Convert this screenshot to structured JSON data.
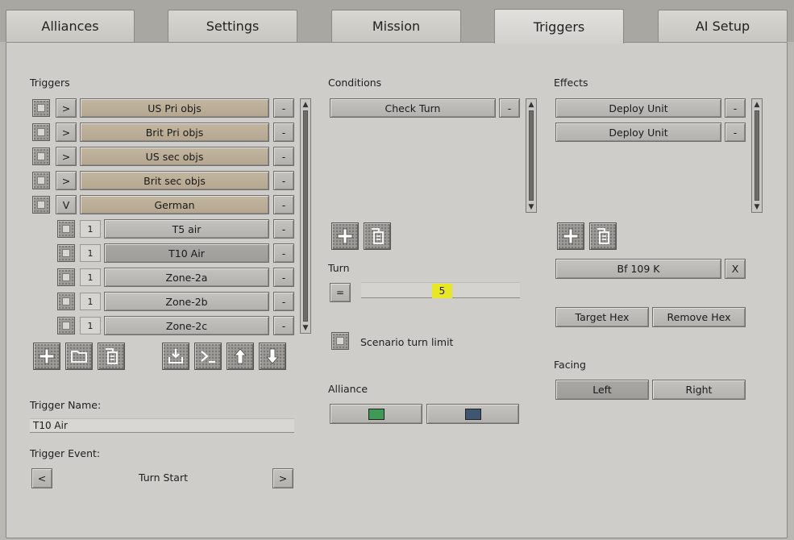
{
  "tabs": [
    {
      "label": "Alliances"
    },
    {
      "label": "Settings"
    },
    {
      "label": "Mission"
    },
    {
      "label": "Triggers"
    },
    {
      "label": "AI Setup"
    }
  ],
  "triggers": {
    "heading": "Triggers",
    "groups": [
      {
        "expander": ">",
        "name": "US Pri objs",
        "remove": "-"
      },
      {
        "expander": ">",
        "name": "Brit Pri objs",
        "remove": "-"
      },
      {
        "expander": ">",
        "name": "US sec objs",
        "remove": "-"
      },
      {
        "expander": ">",
        "name": "Brit sec objs",
        "remove": "-"
      },
      {
        "expander": "V",
        "name": "German",
        "remove": "-"
      }
    ],
    "children": [
      {
        "count": "1",
        "name": "T5 air",
        "remove": "-"
      },
      {
        "count": "1",
        "name": "T10 Air",
        "remove": "-"
      },
      {
        "count": "1",
        "name": "Zone-2a",
        "remove": "-"
      },
      {
        "count": "1",
        "name": "Zone-2b",
        "remove": "-"
      },
      {
        "count": "1",
        "name": "Zone-2c",
        "remove": "-"
      }
    ],
    "name_label": "Trigger Name:",
    "name_value": "T10 Air",
    "event_label": "Trigger Event:",
    "event_prev": "<",
    "event_value": "Turn Start",
    "event_next": ">"
  },
  "conditions": {
    "heading": "Conditions",
    "items": [
      {
        "name": "Check Turn",
        "remove": "-"
      }
    ],
    "turn_label": "Turn",
    "turn_operator": "=",
    "turn_value": "5",
    "scenario_limit_label": "Scenario turn limit",
    "alliance_label": "Alliance",
    "alliance_colors": {
      "first": "#3f9a55",
      "second": "#3e5670"
    }
  },
  "effects": {
    "heading": "Effects",
    "items": [
      {
        "name": "Deploy Unit",
        "remove": "-"
      },
      {
        "name": "Deploy Unit",
        "remove": "-"
      }
    ],
    "unit_value": "Bf 109 K",
    "unit_clear": "X",
    "target_hex": "Target Hex",
    "remove_hex": "Remove Hex",
    "facing_label": "Facing",
    "facing_left": "Left",
    "facing_right": "Right"
  },
  "scroll_arrows": {
    "up": "▲",
    "down": "▼"
  }
}
